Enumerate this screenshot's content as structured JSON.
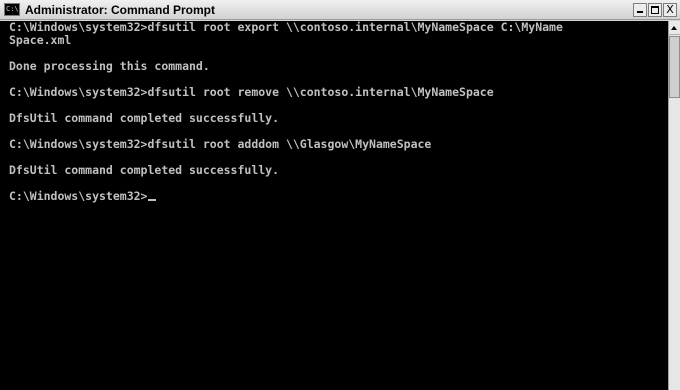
{
  "window": {
    "title": "Administrator: Command Prompt",
    "icon_label": "C:\\."
  },
  "console": {
    "lines": [
      "C:\\Windows\\system32>dfsutil root export \\\\contoso.internal\\MyNameSpace C:\\MyName",
      "Space.xml",
      "Done processing this command.",
      "C:\\Windows\\system32>dfsutil root remove \\\\contoso.internal\\MyNameSpace",
      "DfsUtil command completed successfully.",
      "C:\\Windows\\system32>dfsutil root adddom \\\\Glasgow\\MyNameSpace",
      "DfsUtil command completed successfully.",
      "C:\\Windows\\system32>"
    ]
  },
  "colors": {
    "console_background": "#000000",
    "console_text": "#c0c0c0",
    "titlebar": "#e2e2e2"
  },
  "icons": {
    "app": "command-prompt-icon",
    "minimize": "minimize-icon",
    "maximize": "maximize-icon",
    "close": "close-icon",
    "scroll_up": "arrow-up-icon"
  },
  "buttons": {
    "close_label": "X"
  }
}
